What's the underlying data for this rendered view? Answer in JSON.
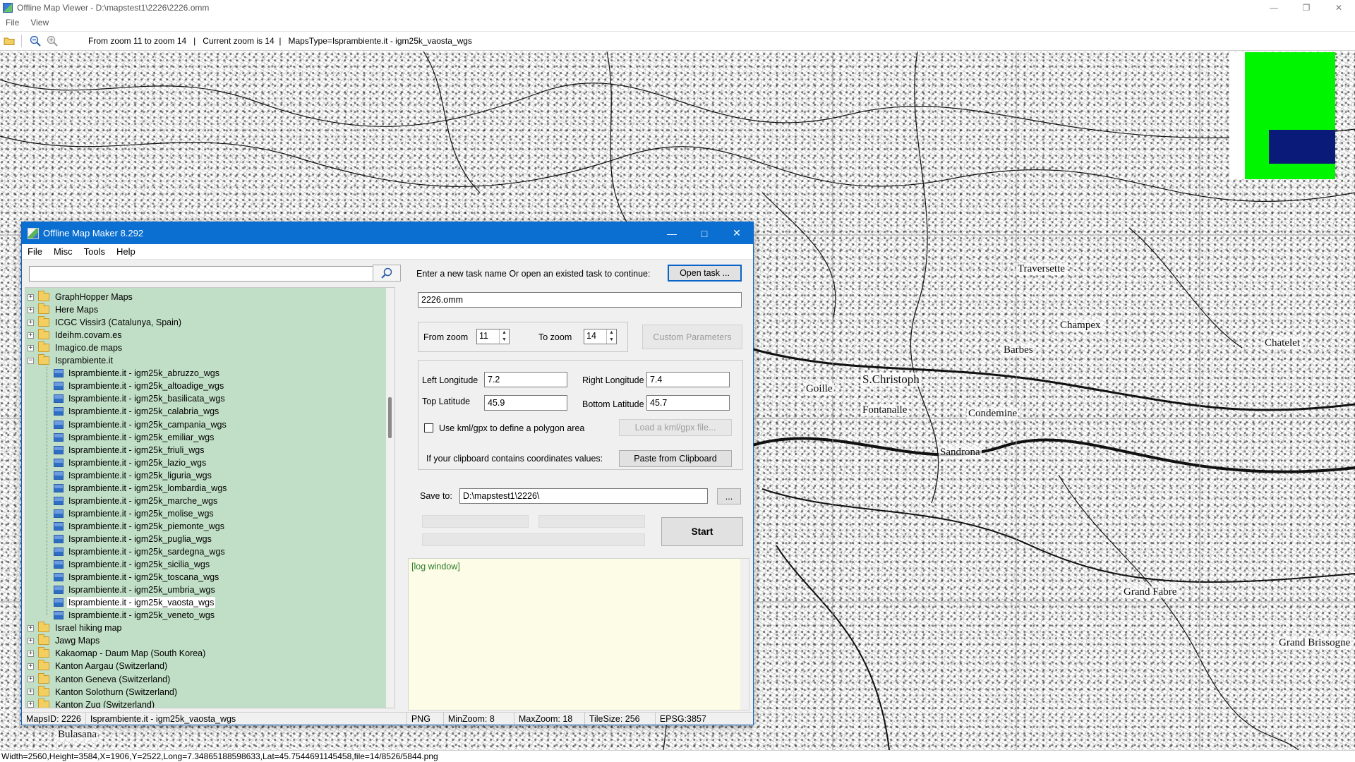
{
  "viewer": {
    "title": "Offline Map Viewer - D:\\mapstest1\\2226\\2226.omm",
    "menu": [
      "File",
      "View"
    ],
    "toolbar": {
      "info": "From zoom 11 to zoom 14   |   Current zoom is 14  |   MapsType=Isprambiente.it - igm25k_vaosta_wgs"
    },
    "status": "Width=2560,Height=3584,X=1906,Y=2522,Long=7.34865188598633,Lat=45.7544691145458,file=14/8526/5844.png",
    "map_labels": [
      "S.Christoph",
      "Fontanalle",
      "Condemine",
      "Grand Fabre",
      "Grand Brissogne",
      "Chatelet",
      "Champex",
      "Goille",
      "Sandrona",
      "Traversette",
      "Bulasana",
      "Barbes"
    ],
    "overview_colors": {
      "field": "#00f500",
      "viewport": "#0a1a78"
    }
  },
  "dialog": {
    "title": "Offline Map Maker 8.292",
    "menu": [
      "File",
      "Misc",
      "Tools",
      "Help"
    ],
    "search": {
      "value": "",
      "placeholder": ""
    },
    "tree": [
      {
        "label": "GraphHopper Maps",
        "type": "folder",
        "expanded": false
      },
      {
        "label": "Here Maps",
        "type": "folder",
        "expanded": false
      },
      {
        "label": "ICGC Vissir3 (Catalunya, Spain)",
        "type": "folder",
        "expanded": false
      },
      {
        "label": "Ideihm.covam.es",
        "type": "folder",
        "expanded": false
      },
      {
        "label": "Imagico.de maps",
        "type": "folder",
        "expanded": false
      },
      {
        "label": "Isprambiente.it",
        "type": "folder",
        "expanded": true
      },
      {
        "label": "Isprambiente.it - igm25k_abruzzo_wgs",
        "type": "map"
      },
      {
        "label": "Isprambiente.it - igm25k_altoadige_wgs",
        "type": "map"
      },
      {
        "label": "Isprambiente.it - igm25k_basilicata_wgs",
        "type": "map"
      },
      {
        "label": "Isprambiente.it - igm25k_calabria_wgs",
        "type": "map"
      },
      {
        "label": "Isprambiente.it - igm25k_campania_wgs",
        "type": "map"
      },
      {
        "label": "Isprambiente.it - igm25k_emiliar_wgs",
        "type": "map"
      },
      {
        "label": "Isprambiente.it - igm25k_friuli_wgs",
        "type": "map"
      },
      {
        "label": "Isprambiente.it - igm25k_lazio_wgs",
        "type": "map"
      },
      {
        "label": "Isprambiente.it - igm25k_liguria_wgs",
        "type": "map"
      },
      {
        "label": "Isprambiente.it - igm25k_lombardia_wgs",
        "type": "map"
      },
      {
        "label": "Isprambiente.it - igm25k_marche_wgs",
        "type": "map"
      },
      {
        "label": "Isprambiente.it - igm25k_molise_wgs",
        "type": "map"
      },
      {
        "label": "Isprambiente.it - igm25k_piemonte_wgs",
        "type": "map"
      },
      {
        "label": "Isprambiente.it - igm25k_puglia_wgs",
        "type": "map"
      },
      {
        "label": "Isprambiente.it - igm25k_sardegna_wgs",
        "type": "map"
      },
      {
        "label": "Isprambiente.it - igm25k_sicilia_wgs",
        "type": "map"
      },
      {
        "label": "Isprambiente.it - igm25k_toscana_wgs",
        "type": "map"
      },
      {
        "label": "Isprambiente.it - igm25k_umbria_wgs",
        "type": "map"
      },
      {
        "label": "Isprambiente.it - igm25k_vaosta_wgs",
        "type": "map",
        "selected": true
      },
      {
        "label": "Isprambiente.it - igm25k_veneto_wgs",
        "type": "map"
      },
      {
        "label": "Israel hiking map",
        "type": "folder",
        "expanded": false
      },
      {
        "label": "Jawg Maps",
        "type": "folder",
        "expanded": false
      },
      {
        "label": "Kakaomap - Daum Map (South Korea)",
        "type": "folder",
        "expanded": false
      },
      {
        "label": "Kanton Aargau (Switzerland)",
        "type": "folder",
        "expanded": false
      },
      {
        "label": "Kanton Geneva (Switzerland)",
        "type": "folder",
        "expanded": false
      },
      {
        "label": "Kanton Solothurn (Switzerland)",
        "type": "folder",
        "expanded": false
      },
      {
        "label": "Kanton Zug (Switzerland)",
        "type": "folder",
        "expanded": false
      }
    ],
    "task": {
      "prompt": "Enter a new task name Or open an existed task to continue:",
      "open_button": "Open task ...",
      "name": "2226.omm"
    },
    "zoom": {
      "from_label": "From zoom",
      "from_value": "11",
      "to_label": "To zoom",
      "to_value": "14",
      "custom_button": "Custom Parameters"
    },
    "coords": {
      "left_lon_label": "Left Longitude",
      "left_lon": "7.2",
      "right_lon_label": "Right Longitude",
      "right_lon": "7.4",
      "top_lat_label": "Top Latitude",
      "top_lat": "45.9",
      "bottom_lat_label": "Bottom Latitude",
      "bottom_lat": "45.7",
      "kml_checkbox_label": "Use kml/gpx to define a polygon area",
      "kml_checked": false,
      "kml_button": "Load a kml/gpx file...",
      "clipboard_label": "If your clipboard contains coordinates values:",
      "clipboard_button": "Paste from Clipboard"
    },
    "save": {
      "label": "Save to:",
      "path": "D:\\mapstest1\\2226\\",
      "browse_button": "..."
    },
    "start_button": "Start",
    "log": "[log window]",
    "status": {
      "maps_id": "MapsID: 2226",
      "maps_name": "Isprambiente.it - igm25k_vaosta_wgs",
      "format": "PNG",
      "min_zoom": "MinZoom: 8",
      "max_zoom": "MaxZoom: 18",
      "tile_size": "TileSize: 256",
      "epsg": "EPSG:3857"
    }
  }
}
